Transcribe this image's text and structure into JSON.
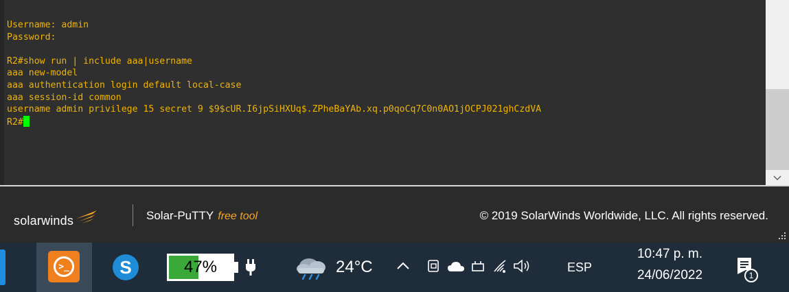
{
  "terminal": {
    "lines": [
      "Username: admin",
      "Password:",
      "",
      "R2#show run | include aaa|username",
      "aaa new-model",
      "aaa authentication login default local-case",
      "aaa session-id common",
      "username admin privilege 15 secret 9 $9$cUR.I6jpSiHXUq$.ZPheBaYAb.xq.p0qoCq7C0n0AO1jOCPJ021ghCzdVA"
    ],
    "prompt": "R2#",
    "text_color": "#f0b400",
    "cursor_color": "#00ff00"
  },
  "footer": {
    "brand": "solarwinds",
    "product": "Solar-PuTTY",
    "free_tool": "free tool",
    "copyright": "© 2019 SolarWinds Worldwide, LLC. All rights reserved."
  },
  "taskbar": {
    "apps": [
      {
        "name": "solar-putty",
        "icon": "putty-icon",
        "active": true
      },
      {
        "name": "skype",
        "icon": "skype-icon",
        "letter": "S"
      }
    ],
    "battery": {
      "label": "47%",
      "level": 0.47,
      "charging": true
    },
    "weather": {
      "temp": "24°C",
      "icon": "cloud-rain-icon"
    },
    "language": "ESP",
    "time": "10:47 p. m.",
    "date": "24/06/2022",
    "notification_count": "1"
  }
}
